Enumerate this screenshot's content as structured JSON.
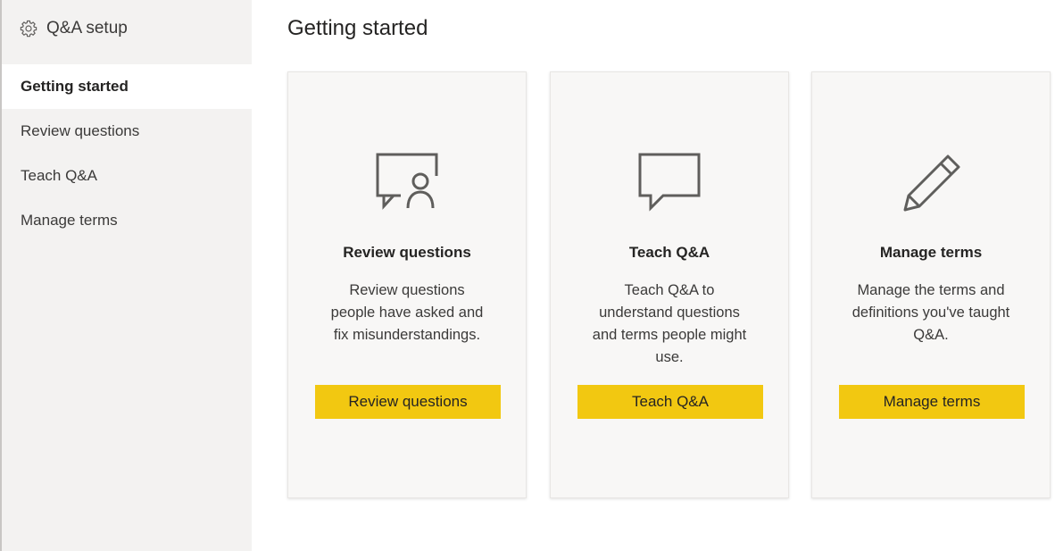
{
  "sidebar": {
    "title": "Q&A setup",
    "icon": "gear-icon",
    "items": [
      {
        "label": "Getting started",
        "active": true
      },
      {
        "label": "Review questions",
        "active": false
      },
      {
        "label": "Teach Q&A",
        "active": false
      },
      {
        "label": "Manage terms",
        "active": false
      }
    ]
  },
  "main": {
    "title": "Getting started",
    "cards": [
      {
        "icon": "chat-person-icon",
        "title": "Review questions",
        "description": "Review questions people have asked and fix misunderstandings.",
        "button": "Review questions"
      },
      {
        "icon": "chat-bubble-icon",
        "title": "Teach Q&A",
        "description": "Teach Q&A to understand questions and terms people might use.",
        "button": "Teach Q&A"
      },
      {
        "icon": "pencil-icon",
        "title": "Manage terms",
        "description": "Manage the terms and definitions you've taught Q&A.",
        "button": "Manage terms"
      }
    ]
  },
  "colors": {
    "accent": "#f2c811",
    "sidebar_bg": "#f3f2f1",
    "card_bg": "#f8f7f6",
    "icon_stroke": "#5f5e5c"
  }
}
